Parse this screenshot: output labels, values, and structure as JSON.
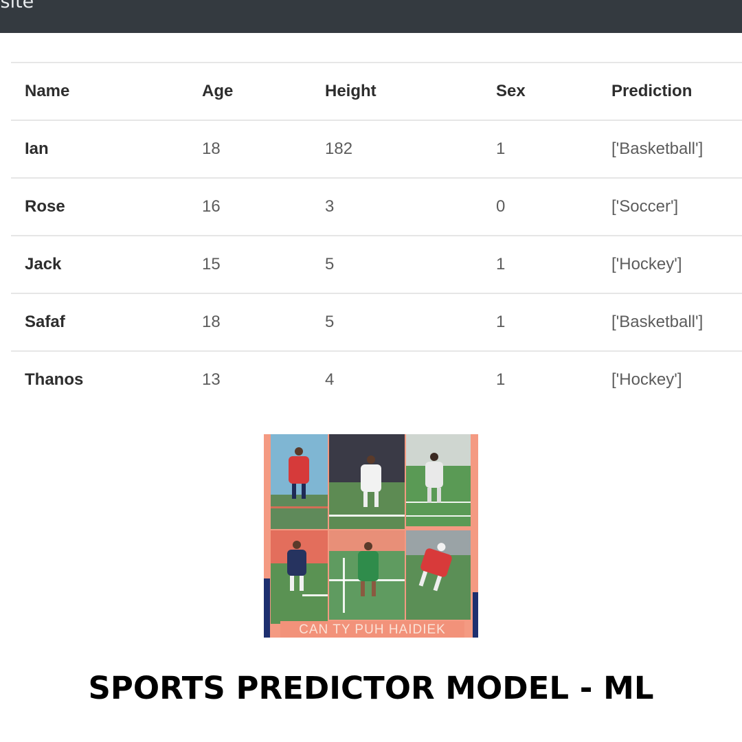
{
  "header": {
    "brand_fragment": "osite"
  },
  "table": {
    "columns": [
      "Name",
      "Age",
      "Height",
      "Sex",
      "Prediction"
    ],
    "rows": [
      {
        "name": "Ian",
        "age": "18",
        "height": "182",
        "sex": "1",
        "prediction": "['Basketball']"
      },
      {
        "name": "Rose",
        "age": "16",
        "height": "3",
        "sex": "0",
        "prediction": "['Soccer']"
      },
      {
        "name": "Jack",
        "age": "15",
        "height": "5",
        "sex": "1",
        "prediction": "['Hockey']"
      },
      {
        "name": "Safaf",
        "age": "18",
        "height": "5",
        "sex": "1",
        "prediction": "['Basketball']"
      },
      {
        "name": "Thanos",
        "age": "13",
        "height": "4",
        "sex": "1",
        "prediction": "['Hockey']"
      }
    ]
  },
  "collage": {
    "banner_text": "CAN TY PUH HAIDIEK"
  },
  "title": "SPORTS PREDICTOR MODEL - ML",
  "colors": {
    "navbar": "#343a40",
    "table_border": "#e6e6e6",
    "collage_frame": "#f49a82",
    "collage_stripe": "#1d2f6f"
  }
}
